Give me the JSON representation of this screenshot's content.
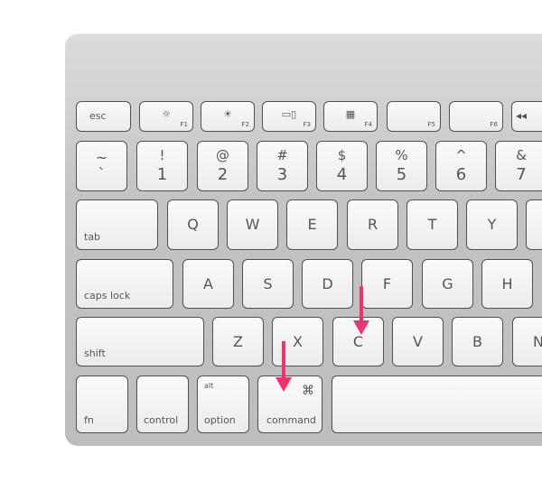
{
  "keys": {
    "esc": "esc",
    "f1": "F1",
    "f2": "F2",
    "f3": "F3",
    "f4": "F4",
    "f5": "F5",
    "f6": "F6",
    "f1_icon": "☼",
    "f2_icon": "☀",
    "f3_icon": "▭▯",
    "f4_icon": "▦",
    "f7_icon": "◂◂",
    "tilde_top": "~",
    "tilde_bottom": "`",
    "num": [
      [
        "!",
        "1"
      ],
      [
        "@",
        "2"
      ],
      [
        "#",
        "3"
      ],
      [
        "$",
        "4"
      ],
      [
        "%",
        "5"
      ],
      [
        "^",
        "6"
      ],
      [
        "&",
        "7"
      ]
    ],
    "tab": "tab",
    "qrow": [
      "Q",
      "W",
      "E",
      "R",
      "T",
      "Y"
    ],
    "caps": "caps lock",
    "arow": [
      "A",
      "S",
      "D",
      "F",
      "G",
      "H"
    ],
    "shift": "shift",
    "zrow": [
      "Z",
      "X",
      "C",
      "V",
      "B",
      "N"
    ],
    "fn": "fn",
    "control": "control",
    "option_top": "alt",
    "option": "option",
    "command_symbol": "⌘",
    "command": "command"
  },
  "annotations": {
    "arrow_color": "#f0336b",
    "arrows": [
      "points-to-C",
      "points-to-command"
    ]
  }
}
